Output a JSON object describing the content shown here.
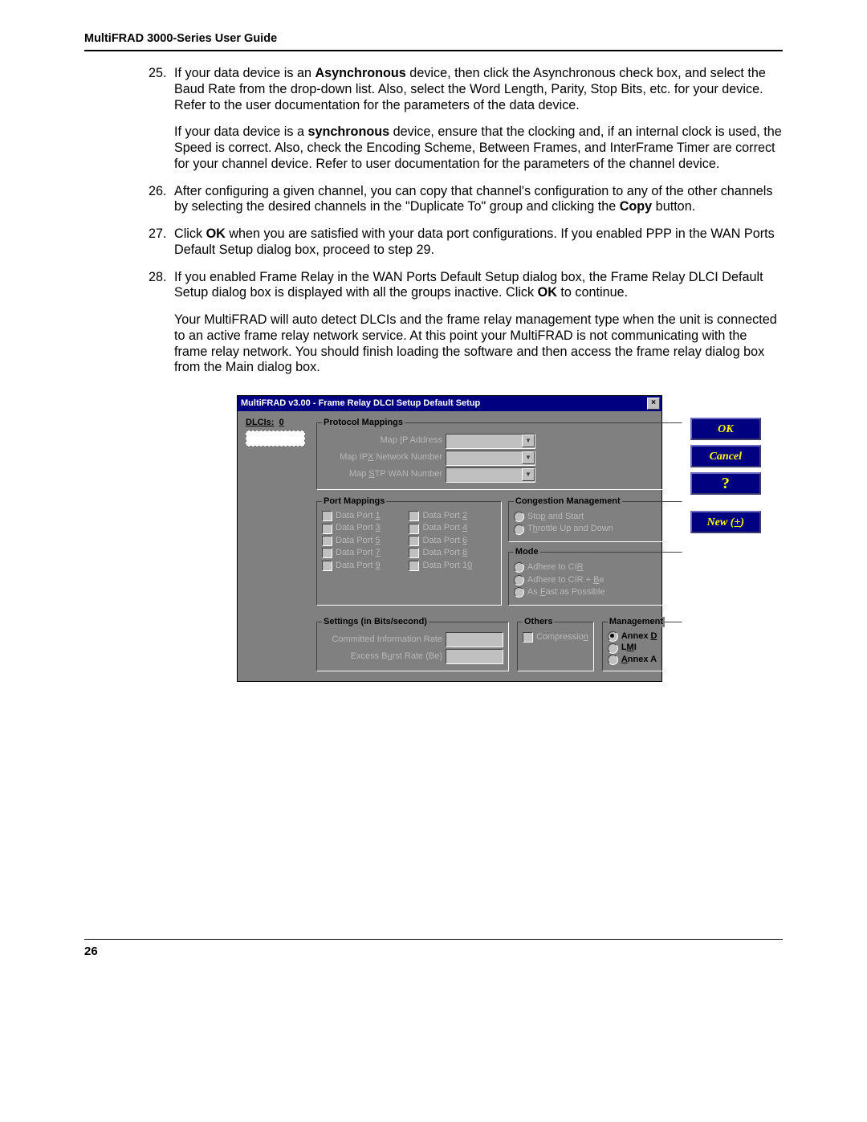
{
  "header": "MultiFRAD 3000-Series User Guide",
  "page_number": "26",
  "steps": [
    {
      "num": "25.",
      "paragraphs": [
        {
          "segments": [
            {
              "t": "If your data device is an "
            },
            {
              "t": "Asynchronous",
              "b": true
            },
            {
              "t": " device, then click the Asynchronous check box, and select the Baud Rate from the drop-down list.  Also, select the Word Length, Parity, Stop Bits, etc. for your device.  Refer to the user documentation for the parameters of the data device."
            }
          ]
        },
        {
          "segments": [
            {
              "t": "If your data device is a "
            },
            {
              "t": "synchronous",
              "b": true
            },
            {
              "t": " device, ensure that the clocking and, if an internal clock is used, the Speed is correct.  Also, check the Encoding Scheme, Between Frames, and InterFrame Timer are correct for your channel device.  Refer to user documentation for the parameters of the channel device."
            }
          ]
        }
      ]
    },
    {
      "num": "26.",
      "paragraphs": [
        {
          "segments": [
            {
              "t": "After configuring a given channel, you can copy that channel's configuration to any of the other channels by selecting the desired channels in the \"Duplicate To\" group and clicking the "
            },
            {
              "t": "Copy",
              "b": true
            },
            {
              "t": " button."
            }
          ]
        }
      ]
    },
    {
      "num": "27.",
      "paragraphs": [
        {
          "segments": [
            {
              "t": "Click "
            },
            {
              "t": "OK",
              "b": true
            },
            {
              "t": " when you are satisfied with your data port configurations.  If you enabled PPP in the WAN Ports Default Setup dialog box, proceed to step 29."
            }
          ]
        }
      ]
    },
    {
      "num": "28.",
      "paragraphs": [
        {
          "segments": [
            {
              "t": "If you enabled Frame Relay in the WAN Ports Default Setup dialog box, the Frame Relay DLCI Default Setup dialog box is displayed with all the groups inactive.  Click "
            },
            {
              "t": "OK",
              "b": true
            },
            {
              "t": " to continue."
            }
          ]
        },
        {
          "segments": [
            {
              "t": "Your MultiFRAD will auto detect DLCIs and the frame relay management type when the unit is connected to an active frame relay network service.  At this point your MultiFRAD is not communicating with the frame relay network.  You should finish loading the software and then access the frame relay dialog box from the Main dialog box."
            }
          ]
        }
      ]
    }
  ],
  "dialog": {
    "title": "MultiFRAD v3.00 - Frame Relay DLCI Setup Default Setup",
    "close": "×",
    "dlcis_prefix": "D",
    "dlcis_rest": "LCIs:",
    "dlcis_value": "0",
    "groups": {
      "protocol": {
        "legend": "Protocol Mappings",
        "ip": "Map IP Address",
        "ip_ul": "I",
        "ipx": "Map IPX Network Number",
        "ipx_ul": "X",
        "stp": "Map STP WAN Number",
        "stp_ul": "S"
      },
      "port": {
        "legend": "Port Mappings",
        "items": [
          {
            "label": "Data Port ",
            "ul": "1"
          },
          {
            "label": "Data Port ",
            "ul": "2"
          },
          {
            "label": "Data Port ",
            "ul": "3"
          },
          {
            "label": "Data Port ",
            "ul": "4"
          },
          {
            "label": "Data Port ",
            "ul": "5"
          },
          {
            "label": "Data Port ",
            "ul": "6"
          },
          {
            "label": "Data Port ",
            "ul": "7"
          },
          {
            "label": "Data Port ",
            "ul": "8"
          },
          {
            "label": "Data Port ",
            "ul": "9"
          },
          {
            "label": "Data Port 1",
            "ul": "0"
          }
        ]
      },
      "congestion": {
        "legend": "Congestion Management",
        "stop": "Stop and Start",
        "stop_ul": "p",
        "throttle": "Throttle Up and Down",
        "throttle_ul": "h"
      },
      "mode": {
        "legend": "Mode",
        "cir": "Adhere to CIR",
        "cir_ul": "R",
        "cirbe": "Adhere to CIR + Be",
        "cirbe_ul": "B",
        "fast": "As Fast as Possible",
        "fast_ul": "F"
      },
      "settings": {
        "legend": "Settings (in Bits/second)",
        "cir": "Committed Information Rate",
        "be": "Excess Burst Rate (Be)",
        "be_ul": "u"
      },
      "others": {
        "legend": "Others",
        "comp": "Compression",
        "comp_ul": "n"
      },
      "management": {
        "legend": "Management",
        "annexd": "Annex D",
        "annexd_ul": "D",
        "lmi": "LMI",
        "lmi_ul": "M",
        "annexa": "Annex A",
        "annexa_ul": "A"
      }
    },
    "buttons": {
      "ok": "OK",
      "cancel": "Cancel",
      "help": "?",
      "new": "New (+)"
    }
  }
}
